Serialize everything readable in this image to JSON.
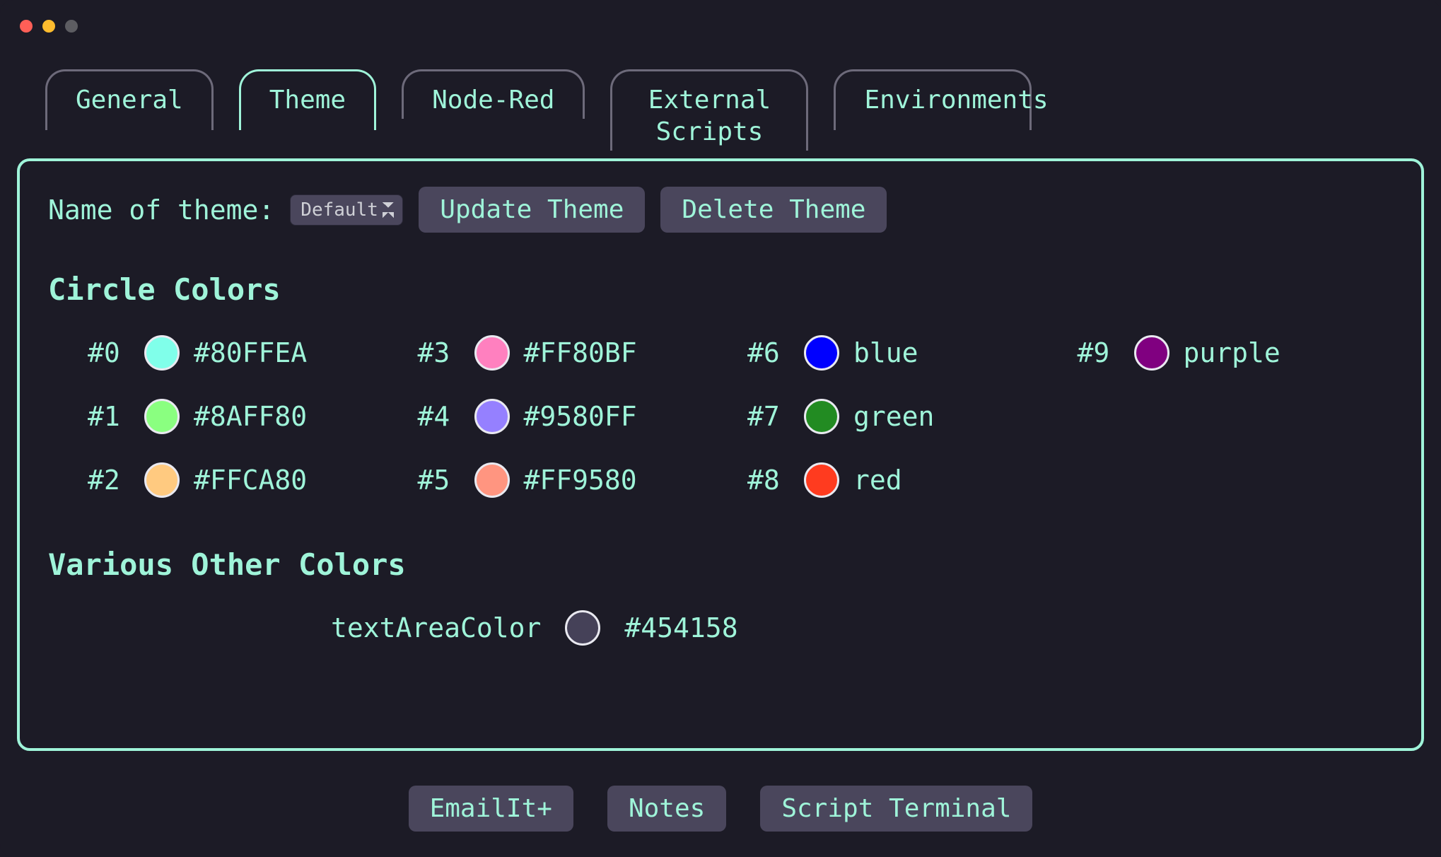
{
  "tabs": {
    "general": "General",
    "theme": "Theme",
    "nodeRed": "Node-Red",
    "external": "External Scripts",
    "environments": "Environments",
    "active": "theme"
  },
  "themeRow": {
    "label": "Name of theme:",
    "selected": "Default",
    "update": "Update Theme",
    "delete": "Delete Theme"
  },
  "sections": {
    "circle": "Circle Colors",
    "other": "Various Other Colors"
  },
  "circleColors": [
    {
      "idx": "#0",
      "hex": "#80FFEA",
      "label": "#80FFEA"
    },
    {
      "idx": "#1",
      "hex": "#8AFF80",
      "label": "#8AFF80"
    },
    {
      "idx": "#2",
      "hex": "#FFCA80",
      "label": "#FFCA80"
    },
    {
      "idx": "#3",
      "hex": "#FF80BF",
      "label": "#FF80BF"
    },
    {
      "idx": "#4",
      "hex": "#9580FF",
      "label": "#9580FF"
    },
    {
      "idx": "#5",
      "hex": "#FF9580",
      "label": "#FF9580"
    },
    {
      "idx": "#6",
      "hex": "#0000FF",
      "label": "blue"
    },
    {
      "idx": "#7",
      "hex": "#228B22",
      "label": "green"
    },
    {
      "idx": "#8",
      "hex": "#FF3B1F",
      "label": "red"
    },
    {
      "idx": "#9",
      "hex": "#800080",
      "label": "purple"
    }
  ],
  "otherColors": [
    {
      "name": "textAreaColor",
      "hex": "#454158",
      "label": "#454158"
    }
  ],
  "bottom": {
    "emailit": "EmailIt+",
    "notes": "Notes",
    "script": "Script Terminal"
  }
}
